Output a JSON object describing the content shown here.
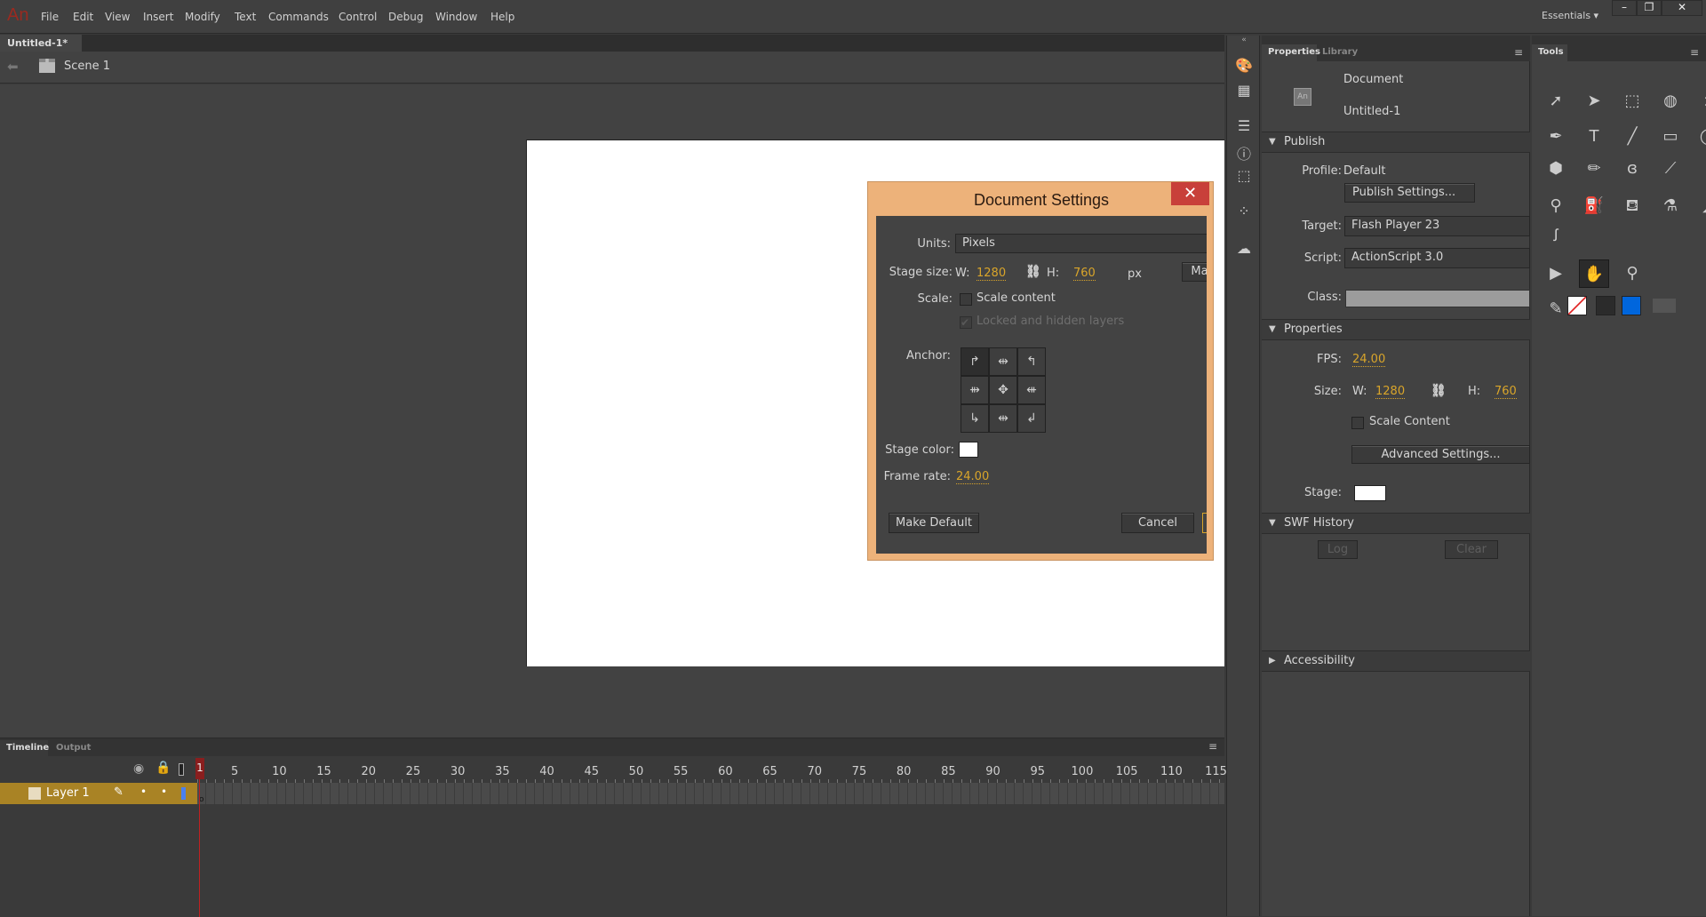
{
  "app": {
    "logo": "An",
    "workspace": "Essentials ▾"
  },
  "menu": [
    "File",
    "Edit",
    "View",
    "Insert",
    "Modify",
    "Text",
    "Commands",
    "Control",
    "Debug",
    "Window",
    "Help"
  ],
  "window_controls": [
    "–",
    "❐",
    "✕"
  ],
  "document_tab": {
    "title": "Untitled-1*",
    "close": "×"
  },
  "scene": {
    "label": "Scene 1"
  },
  "dialog": {
    "title": "Document Settings",
    "close": "✕",
    "units_label": "Units:",
    "units_value": "Pixels",
    "stage_size_label": "Stage size:",
    "w_label": "W:",
    "width": "1280",
    "h_label": "H:",
    "height": "760",
    "unit": "px",
    "match_button": "Ma",
    "scale_label": "Scale:",
    "scale_content": "Scale content",
    "scale_content_checked": false,
    "locked_layers": "Locked and hidden layers",
    "locked_layers_checked": true,
    "anchor_label": "Anchor:",
    "stage_color_label": "Stage color:",
    "stage_color": "#ffffff",
    "frame_rate_label": "Frame rate:",
    "frame_rate": "24.00",
    "make_default": "Make Default",
    "cancel": "Cancel"
  },
  "properties": {
    "tabs": [
      "Properties",
      "Library"
    ],
    "doc_type": "Document",
    "doc_name": "Untitled-1",
    "doc_icon": "An",
    "publish": {
      "header": "Publish",
      "profile_label": "Profile:",
      "profile": "Default",
      "publish_settings": "Publish Settings...",
      "target_label": "Target:",
      "target": "Flash Player 23",
      "script_label": "Script:",
      "script": "ActionScript 3.0",
      "class_label": "Class:"
    },
    "props": {
      "header": "Properties",
      "fps_label": "FPS:",
      "fps": "24.00",
      "size_label": "Size:",
      "w_label": "W:",
      "width": "1280",
      "h_label": "H:",
      "height": "760",
      "scale_content": "Scale Content",
      "advanced": "Advanced Settings...",
      "stage_label": "Stage:",
      "stage_color": "#ffffff"
    },
    "swf": {
      "header": "SWF History",
      "log": "Log",
      "clear": "Clear"
    },
    "accessibility": {
      "header": "Accessibility"
    }
  },
  "tools": {
    "title": "Tools",
    "fill_color": "#0066dd"
  },
  "timeline": {
    "tabs": [
      "Timeline",
      "Output"
    ],
    "layer": "Layer 1",
    "frame_numbers": [
      "1",
      "5",
      "10",
      "15",
      "20",
      "25",
      "30",
      "35",
      "40",
      "45",
      "50",
      "55",
      "60",
      "65",
      "70",
      "75",
      "80",
      "85",
      "90",
      "95",
      "100",
      "105",
      "110",
      "115"
    ],
    "current_frame": 1
  }
}
